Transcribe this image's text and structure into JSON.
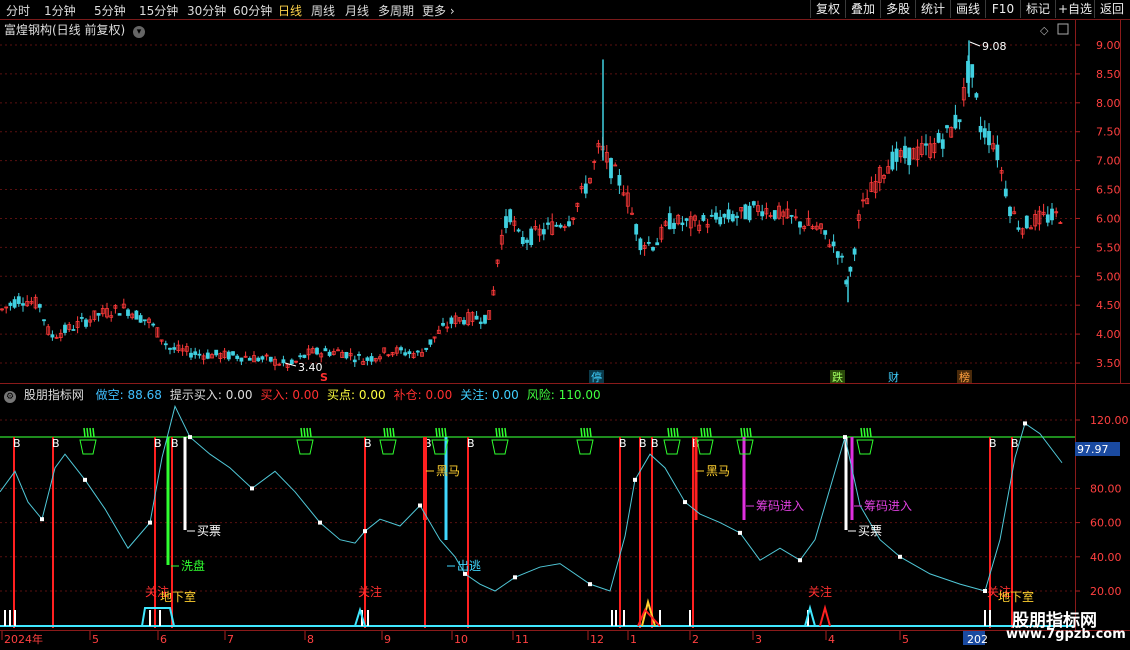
{
  "toolbar": {
    "tabs": [
      "分时",
      "1分钟",
      "5分钟",
      "15分钟",
      "30分钟",
      "60分钟",
      "日线",
      "周线",
      "月线",
      "多周期",
      "更多"
    ],
    "active_tab": "日线",
    "buttons": [
      "复权",
      "叠加",
      "多股",
      "统计",
      "画线",
      "F10",
      "标记",
      "+自选",
      "返回"
    ]
  },
  "main_chart": {
    "title": "富煌钢构(日线 前复权)",
    "price_axis": [
      "9.00",
      "8.50",
      "8.00",
      "7.50",
      "7.00",
      "6.50",
      "6.00",
      "5.50",
      "5.00",
      "4.50",
      "4.00",
      "3.50"
    ],
    "high_label": "9.08",
    "low_label": "3.40",
    "event_marks": [
      {
        "text": "S",
        "color": "#ff3030"
      },
      {
        "text": "停",
        "color": "#40d0ff"
      },
      {
        "text": "跌",
        "color": "#a0ff60"
      },
      {
        "text": "财",
        "color": "#40d0ff"
      },
      {
        "text": "榜",
        "color": "#ffa040"
      }
    ]
  },
  "indicator": {
    "name": "股朋指标网",
    "fields": [
      {
        "label": "做空:",
        "value": "88.68",
        "color": "#40c0ff"
      },
      {
        "label": "提示买入:",
        "value": "0.00",
        "color": "#dddddd"
      },
      {
        "label": "买入:",
        "value": "0.00",
        "color": "#ff3030"
      },
      {
        "label": "买点:",
        "value": "0.00",
        "color": "#ffff40"
      },
      {
        "label": "补仓:",
        "value": "0.00",
        "color": "#ff3030"
      },
      {
        "label": "关注:",
        "value": "0.00",
        "color": "#40d0ff"
      },
      {
        "label": "风险:",
        "value": "110.00",
        "color": "#40ff40"
      }
    ],
    "axis": [
      "120.00",
      "80.00",
      "60.00",
      "40.00",
      "20.00"
    ],
    "current_value": "97.97",
    "annotations": {
      "buy_ticket": "买票",
      "wash": "洗盘",
      "escape": "出逃",
      "dark_horse": "黑马",
      "chips_in": "筹码进入",
      "attention": "关注",
      "basement": "地下室",
      "b_mark": "B"
    }
  },
  "date_axis": [
    "2024年",
    "5",
    "6",
    "7",
    "8",
    "9",
    "10",
    "11",
    "12",
    "1",
    "2",
    "3",
    "4",
    "5",
    "202"
  ],
  "watermark": {
    "name": "股朋指标网",
    "url": "www.7gpzb.com"
  }
}
